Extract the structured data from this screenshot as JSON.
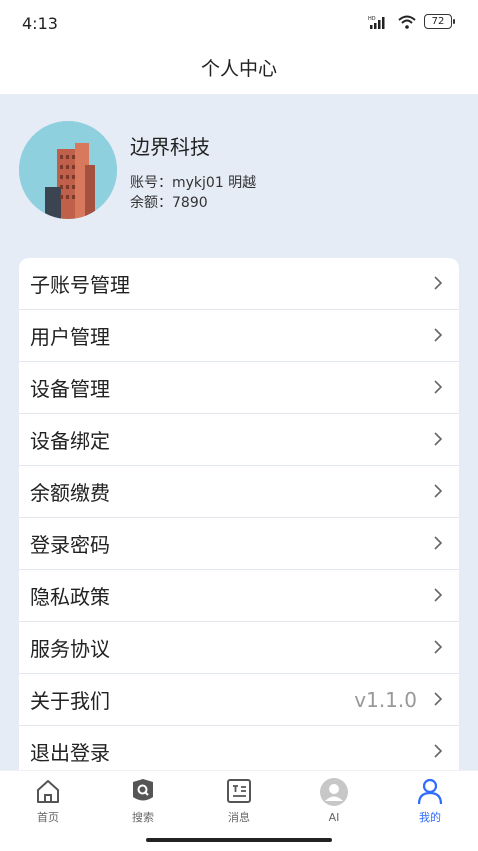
{
  "status": {
    "time": "4:13",
    "battery": "72"
  },
  "header": {
    "title": "个人中心"
  },
  "profile": {
    "company": "边界科技",
    "account": "账号：mykj01   明越",
    "balance": "余额：7890"
  },
  "menu": {
    "items": [
      {
        "label": "子账号管理"
      },
      {
        "label": "用户管理"
      },
      {
        "label": "设备管理"
      },
      {
        "label": "设备绑定"
      },
      {
        "label": "余额缴费"
      },
      {
        "label": "登录密码"
      },
      {
        "label": "隐私政策"
      },
      {
        "label": "服务协议"
      },
      {
        "label": "关于我们",
        "value": "v1.1.0"
      },
      {
        "label": "退出登录"
      }
    ]
  },
  "tabbar": {
    "tabs": [
      {
        "label": "首页",
        "icon": "home-icon"
      },
      {
        "label": "搜索",
        "icon": "search-icon"
      },
      {
        "label": "消息",
        "icon": "message-icon"
      },
      {
        "label": "AI",
        "icon": "ai-icon"
      },
      {
        "label": "我的",
        "icon": "user-icon",
        "active": true
      }
    ],
    "active_color": "#2f6bff"
  }
}
